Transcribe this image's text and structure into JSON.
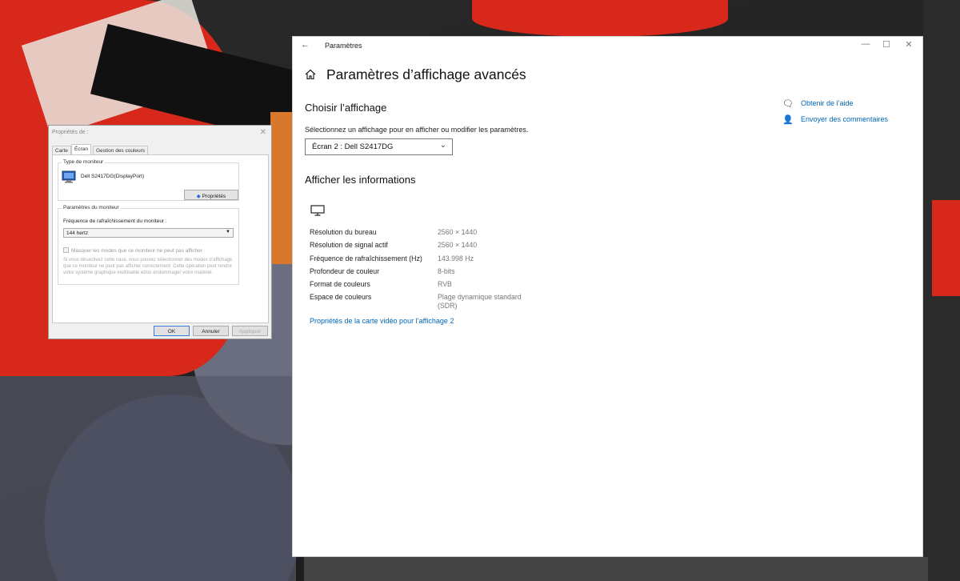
{
  "settings_window": {
    "app_title": "Paramètres",
    "back_glyph": "←",
    "minimize_glyph": "—",
    "maximize_glyph": "☐",
    "close_glyph": "✕",
    "page_title": "Paramètres d’affichage avancés",
    "choose_display": {
      "heading": "Choisir l’affichage",
      "description": "Sélectionnez un affichage pour en afficher ou modifier les paramètres.",
      "selected_display": "Écran 2 : Dell S2417DG"
    },
    "display_info": {
      "heading": "Afficher les informations",
      "rows": [
        {
          "label": "Résolution du bureau",
          "value": "2560 × 1440"
        },
        {
          "label": "Résolution de signal actif",
          "value": "2560 × 1440"
        },
        {
          "label": "Fréquence de rafraîchissement (Hz)",
          "value": "143.998 Hz"
        },
        {
          "label": "Profondeur de couleur",
          "value": "8-bits"
        },
        {
          "label": "Format de couleurs",
          "value": "RVB"
        },
        {
          "label": "Espace de couleurs",
          "value": "Plage dynamique standard",
          "value2": "(SDR)"
        }
      ],
      "adapter_link": "Propriétés de la carte vidéo pour l’affichage 2"
    },
    "help": {
      "get_help": "Obtenir de l’aide",
      "feedback": "Envoyer des commentaires"
    }
  },
  "properties_dialog": {
    "title": "Propriétés de :",
    "close_glyph": "✕",
    "tabs": [
      "Carte",
      "Écran",
      "Gestion des couleurs"
    ],
    "active_tab": "Écran",
    "monitor_type": {
      "group_title": "Type de moniteur",
      "monitor_name": "Dell S2417DG(DisplayPort)",
      "properties_button": "Propriétés"
    },
    "monitor_settings": {
      "group_title": "Paramètres du moniteur",
      "refresh_label": "Fréquence de rafraîchissement du moniteur :",
      "refresh_value": "144 hertz",
      "hide_modes_label": "Masquer les modes que ce moniteur ne peut pas afficher",
      "warning": "Si vous désactivez cette case, vous pouvez sélectionner des modes d’affichage que ce moniteur ne peut pas afficher correctement. Cette opération peut rendre votre système graphique inutilisable et/ou endommager votre matériel."
    },
    "buttons": {
      "ok": "OK",
      "cancel": "Annuler",
      "apply": "Appliquer"
    }
  },
  "colors": {
    "accent_link": "#0067b8",
    "window_bg": "#ffffff",
    "dialog_bg": "#f0f0f0"
  }
}
